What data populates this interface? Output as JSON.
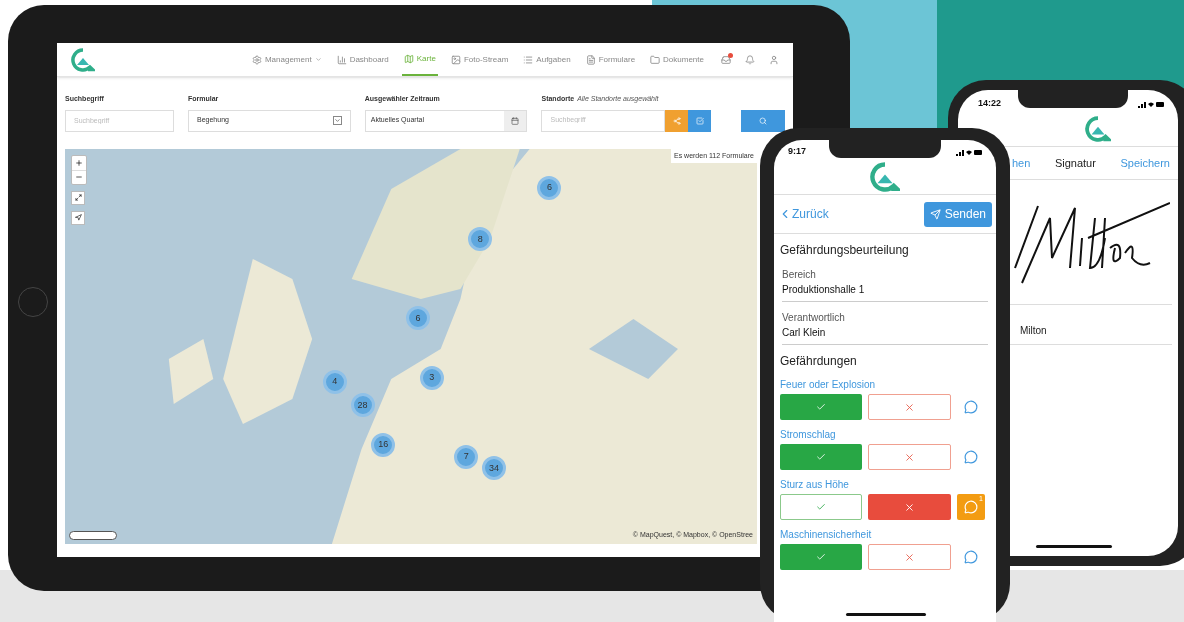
{
  "tablet": {
    "nav": [
      {
        "label": "Management",
        "kind": "dropdown",
        "selected": false
      },
      {
        "label": "Dashboard",
        "kind": "chart",
        "selected": false
      },
      {
        "label": "Karte",
        "kind": "map",
        "selected": true
      },
      {
        "label": "Foto-Stream",
        "kind": "photo",
        "selected": false
      },
      {
        "label": "Aufgaben",
        "kind": "list",
        "selected": false
      },
      {
        "label": "Formulare",
        "kind": "form",
        "selected": false
      },
      {
        "label": "Dokumente",
        "kind": "folder",
        "selected": false
      }
    ],
    "filters": {
      "search": {
        "label": "Suchbegriff",
        "placeholder": "Suchbegriff"
      },
      "form": {
        "label": "Formular",
        "value": "Begehung"
      },
      "period": {
        "label": "Ausgewähler Zeitraum",
        "value": "Aktuelles Quartal"
      },
      "locations": {
        "label": "Standorte",
        "hint": "Alle Standorte ausgewählt",
        "placeholder": "Suchbegriff"
      }
    },
    "map": {
      "info": "Es werden 112 Formulare",
      "attribution": "© MapQuest, © Mapbox, © OpenStree",
      "clusters": [
        "6",
        "8",
        "6",
        "4",
        "3",
        "28",
        "16",
        "7",
        "34"
      ]
    }
  },
  "phone_front": {
    "time": "9:17",
    "back": "Zurück",
    "send": "Senden",
    "title": "Gefährdungsbeurteilung",
    "fields": [
      {
        "label": "Bereich",
        "value": "Produktionshalle 1"
      },
      {
        "label": "Verantwortlich",
        "value": "Carl Klein"
      }
    ],
    "section": "Gefährdungen",
    "hazards": [
      {
        "label": "Feuer oder Explosion",
        "passed": true
      },
      {
        "label": "Stromschlag",
        "passed": true
      },
      {
        "label": "Sturz aus Höhe",
        "passed": false,
        "comments": "1"
      },
      {
        "label": "Maschinensicherheit",
        "passed": true
      }
    ]
  },
  "phone_back": {
    "time": "14:22",
    "tabs": [
      {
        "label": "hen",
        "selected": false
      },
      {
        "label": "Signatur",
        "selected": true
      },
      {
        "label": "Speichern",
        "selected": false
      }
    ],
    "name": "Milton"
  }
}
